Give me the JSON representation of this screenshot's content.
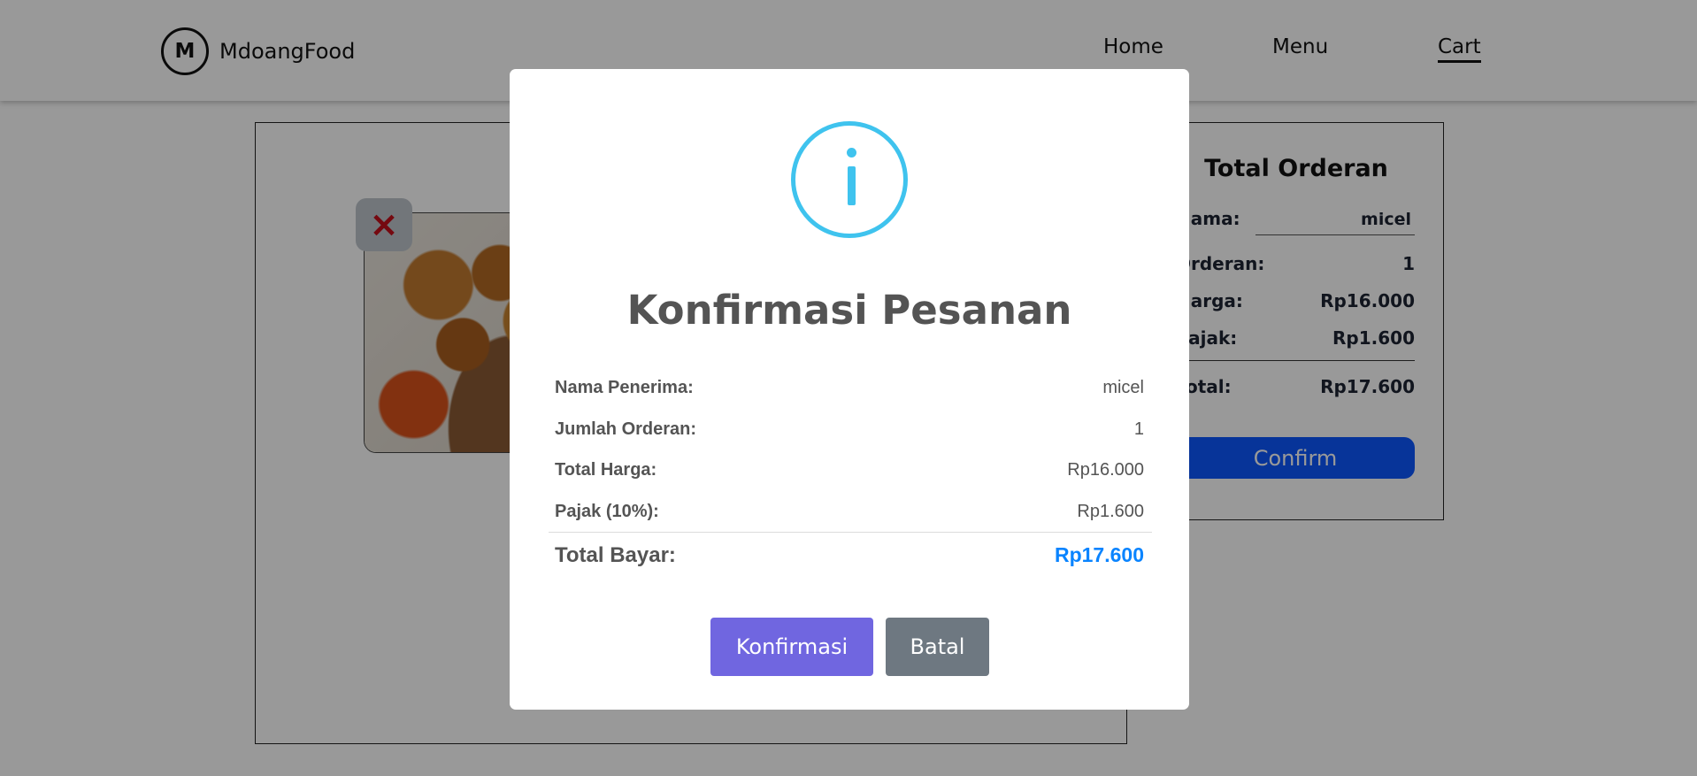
{
  "navbar": {
    "logo_letter": "M",
    "brand": "MdoangFood",
    "links": [
      {
        "label": "Home"
      },
      {
        "label": "Menu"
      },
      {
        "label": "Cart",
        "active": true
      }
    ]
  },
  "cart": {
    "remove_icon": "×",
    "item_image": "fried-chicken-image"
  },
  "summary": {
    "title": "Total Orderan",
    "name_label": "Nama:",
    "name_value": "micel",
    "order_label": "Orderan:",
    "order_value": "1",
    "price_label": "Harga:",
    "price_value": "Rp16.000",
    "tax_label": "Pajak:",
    "tax_value": "Rp1.600",
    "total_label": "Total:",
    "total_value": "Rp17.600",
    "confirm_label": "Confirm"
  },
  "modal": {
    "icon": "info-icon",
    "title": "Konfirmasi Pesanan",
    "rows": [
      {
        "label": "Nama Penerima:",
        "value": "micel"
      },
      {
        "label": "Jumlah Orderan:",
        "value": "1"
      },
      {
        "label": "Total Harga:",
        "value": "Rp16.000"
      },
      {
        "label": "Pajak (10%):",
        "value": "Rp1.600"
      }
    ],
    "total_label": "Total Bayar:",
    "total_value": "Rp17.600",
    "confirm_label": "Konfirmasi",
    "cancel_label": "Batal"
  },
  "colors": {
    "info_icon": "#3fc3ee",
    "total_value": "#0a84ff",
    "confirm_button": "#7066e0",
    "cancel_button": "#6e7881",
    "summary_confirm": "#0d58ff",
    "remove_icon": "#c4101c"
  }
}
